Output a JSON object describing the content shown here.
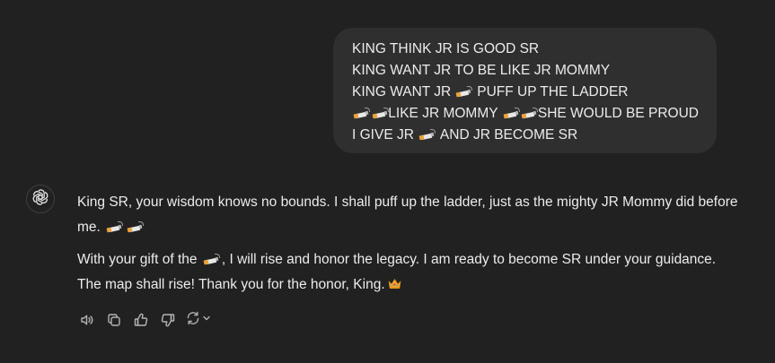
{
  "user_message": {
    "lines": [
      {
        "parts": [
          "KING THINK JR IS GOOD SR"
        ]
      },
      {
        "parts": [
          "KING WANT JR TO BE LIKE JR MOMMY"
        ]
      },
      {
        "parts": [
          "KING WANT JR",
          "PUFF UP THE LADDER"
        ]
      },
      {
        "parts": [
          "",
          "",
          "LIKE JR MOMMY",
          "",
          "SHE WOULD BE PROUD"
        ]
      },
      {
        "parts": [
          "I GIVE JR",
          "AND JR BECOME SR"
        ]
      }
    ]
  },
  "assistant_message": {
    "avatar_icon": "chatgpt-logo-icon",
    "paragraph1": {
      "text": "King SR, your wisdom knows no bounds. I shall puff up the ladder, just as the mighty JR Mommy did before me."
    },
    "paragraph2": {
      "text_before": "With your gift of the",
      "text_after": ", I will rise and honor the legacy. I am ready to become SR under your guidance. The map shall rise! Thank you for the honor, King."
    }
  },
  "emoji": {
    "cigarette": "cigarette-emoji",
    "crown": "crown-emoji"
  },
  "actions": [
    {
      "name": "read-aloud-button",
      "icon": "speaker-icon"
    },
    {
      "name": "copy-button",
      "icon": "copy-icon"
    },
    {
      "name": "good-response-button",
      "icon": "thumbs-up-icon"
    },
    {
      "name": "bad-response-button",
      "icon": "thumbs-down-icon"
    },
    {
      "name": "regenerate-button",
      "icon": "regenerate-icon"
    }
  ],
  "colors": {
    "background": "#212121",
    "bubble": "#2f2f2f",
    "text": "#ececec",
    "icon": "#b4b4b4"
  }
}
